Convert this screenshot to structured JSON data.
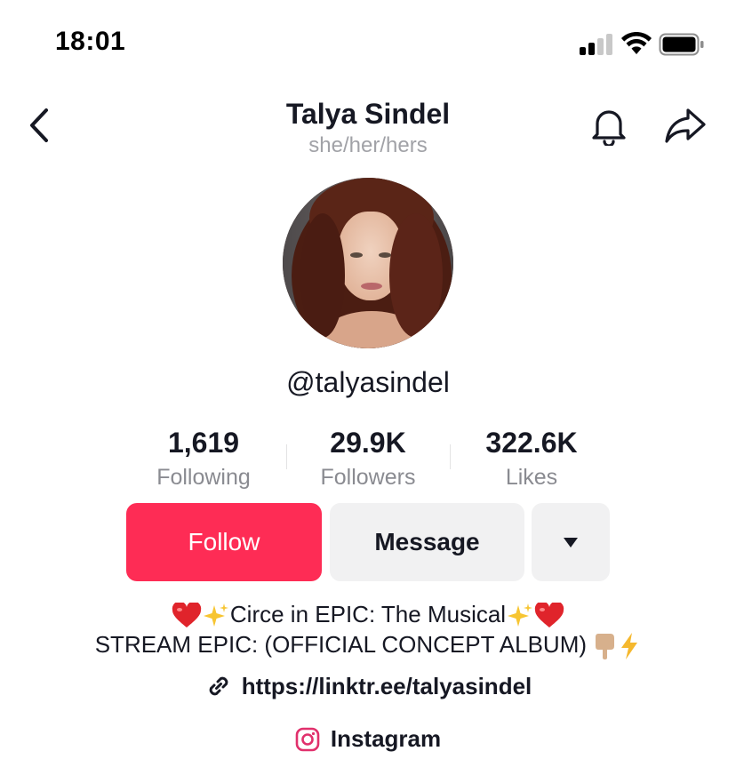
{
  "status_bar": {
    "time": "18:01"
  },
  "header": {
    "name": "Talya Sindel",
    "pronouns": "she/her/hers",
    "icons": [
      "back-chevron-icon",
      "bell-icon",
      "share-arrow-icon"
    ]
  },
  "profile": {
    "handle": "@talyasindel",
    "avatar": "profile-photo"
  },
  "stats": [
    {
      "value": "1,619",
      "label": "Following"
    },
    {
      "value": "29.9K",
      "label": "Followers"
    },
    {
      "value": "322.6K",
      "label": "Likes"
    }
  ],
  "actions": {
    "follow_label": "Follow",
    "message_label": "Message",
    "more_icon": "caret-down-icon"
  },
  "bio": {
    "line1": "Circe in EPIC: The Musical",
    "line2": "STREAM EPIC: (OFFICIAL CONCEPT ALBUM)",
    "link": "https://linktr.ee/talyasindel",
    "instagram_label": "Instagram"
  },
  "colors": {
    "accent": "#fe2c55",
    "secondary_button": "#f1f1f2",
    "muted_text": "#8a8b91",
    "pronoun_text": "#a1a2a7"
  }
}
